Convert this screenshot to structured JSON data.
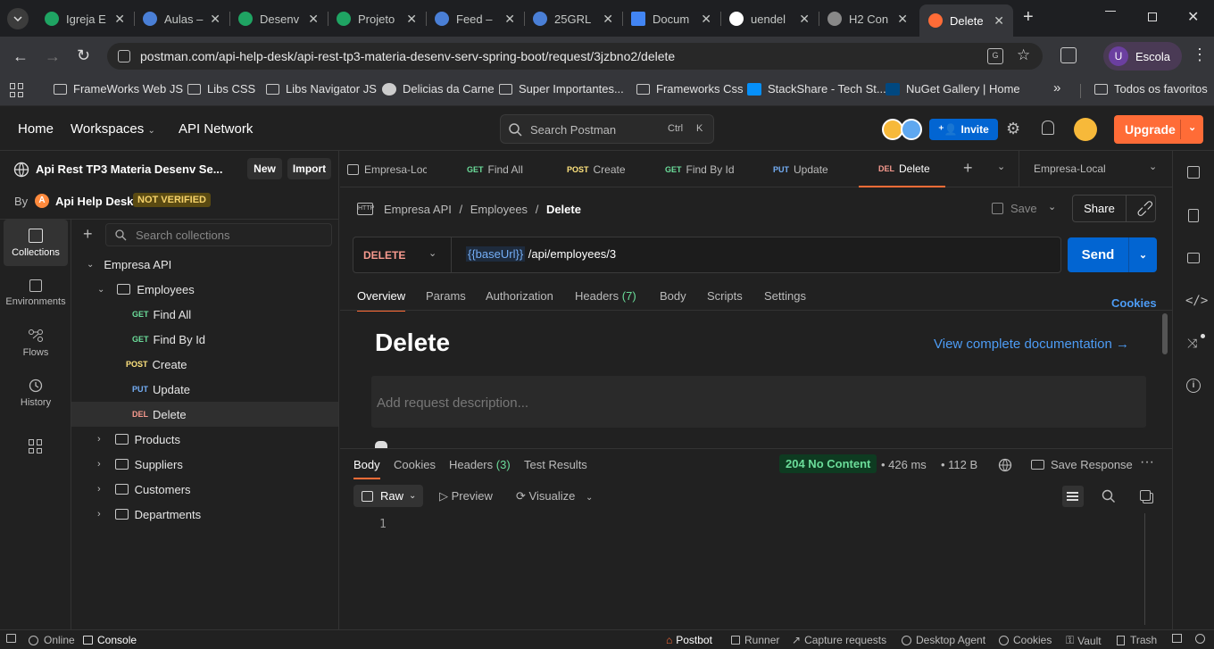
{
  "browser": {
    "tabs": [
      {
        "title": "Igreja E",
        "fav": "#1fa463"
      },
      {
        "title": "Aulas –",
        "fav": "#4a7fd6"
      },
      {
        "title": "Desenv",
        "fav": "#1fa463"
      },
      {
        "title": "Projeto",
        "fav": "#1fa463"
      },
      {
        "title": "Feed –",
        "fav": "#4a7fd6"
      },
      {
        "title": "25GRL",
        "fav": "#4a7fd6"
      },
      {
        "title": "Docum",
        "fav": "#4285f4"
      },
      {
        "title": "uendel",
        "fav": "#ffffff"
      },
      {
        "title": "H2 Con",
        "fav": "#888888"
      },
      {
        "title": "Delete",
        "fav": "#ff6c37"
      }
    ],
    "url": "postman.com/api-help-desk/api-rest-tp3-materia-desenv-serv-spring-boot/request/3jzbno2/delete",
    "profile_letter": "U",
    "profile_name": "Escola",
    "bookmarks": [
      "FrameWorks Web JS",
      "Libs CSS",
      "Libs Navigator JS",
      "Delicias da Carne",
      "Super Importantes...",
      "Frameworks Css",
      "StackShare - Tech St...",
      "NuGet Gallery | Home"
    ],
    "all_bookmarks": "Todos os favoritos",
    "more": "»"
  },
  "header": {
    "home": "Home",
    "workspaces": "Workspaces",
    "api_network": "API Network",
    "search_placeholder": "Search Postman",
    "shortcut_ctrl": "Ctrl",
    "shortcut_k": "K",
    "invite": "Invite",
    "upgrade": "Upgrade"
  },
  "rail": [
    {
      "label": "Collections"
    },
    {
      "label": "Environments"
    },
    {
      "label": "Flows"
    },
    {
      "label": "History"
    }
  ],
  "collection": {
    "workspace_title": "Api Rest TP3 Materia Desenv Se...",
    "new_btn": "New",
    "import_btn": "Import",
    "by": "By",
    "owner_initial": "A",
    "owner": "Api Help Desk",
    "badge": "NOT VERIFIED",
    "search_placeholder": "Search collections",
    "root": "Empresa API",
    "folder_open": "Employees",
    "requests": [
      {
        "method": "GET",
        "name": "Find All"
      },
      {
        "method": "GET",
        "name": "Find By Id"
      },
      {
        "method": "POST",
        "name": "Create"
      },
      {
        "method": "PUT",
        "name": "Update"
      },
      {
        "method": "DEL",
        "name": "Delete"
      }
    ],
    "folders": [
      "Products",
      "Suppliers",
      "Customers",
      "Departments"
    ]
  },
  "request_tabs": [
    {
      "method": "",
      "name": "Empresa-Loca"
    },
    {
      "method": "GET",
      "name": "Find All"
    },
    {
      "method": "POST",
      "name": "Create"
    },
    {
      "method": "GET",
      "name": "Find By Id"
    },
    {
      "method": "PUT",
      "name": "Update"
    },
    {
      "method": "DEL",
      "name": "Delete"
    }
  ],
  "environment": "Empresa-Local",
  "breadcrumb": {
    "a": "Empresa API",
    "b": "Employees",
    "c": "Delete",
    "sep": "/"
  },
  "save": "Save",
  "share": "Share",
  "request": {
    "method": "DELETE",
    "base": "{{baseUrl}}",
    "path": " /api/employees/3",
    "send": "Send"
  },
  "req_tabs": [
    "Overview",
    "Params",
    "Authorization",
    "Headers",
    "Body",
    "Scripts",
    "Settings"
  ],
  "headers_count": "(7)",
  "cookies": "Cookies",
  "overview": {
    "title": "Delete",
    "doc_link": "View complete documentation →",
    "desc_placeholder": "Add request description..."
  },
  "response": {
    "tabs": [
      "Body",
      "Cookies",
      "Headers",
      "Test Results"
    ],
    "headers_count": "(3)",
    "status": "204 No Content",
    "time": "426 ms",
    "size": "112 B",
    "save_response": "Save Response",
    "format": "Raw",
    "preview": "Preview",
    "visualize": "Visualize",
    "line1": "1"
  },
  "status": {
    "online": "Online",
    "console": "Console",
    "postbot": "Postbot",
    "runner": "Runner",
    "capture": "Capture requests",
    "agent": "Desktop Agent",
    "cookies": "Cookies",
    "vault": "Vault",
    "trash": "Trash"
  },
  "colors": {
    "accent": "#ff6c37",
    "send": "#0265d2",
    "invite": "#0265d2",
    "status_ok": "#0e3b21"
  }
}
